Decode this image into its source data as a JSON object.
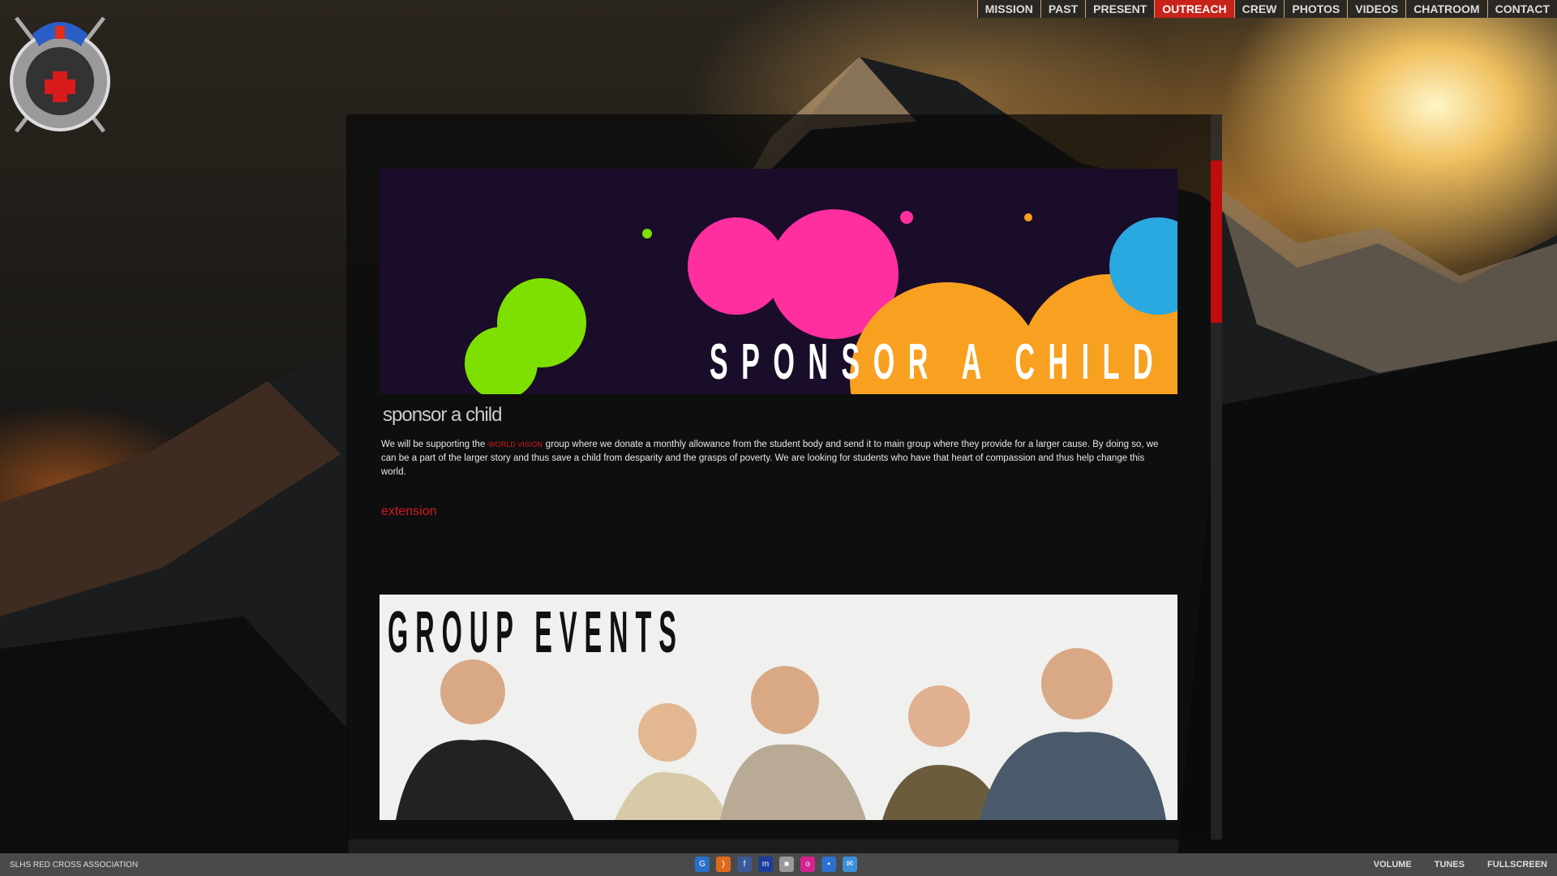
{
  "nav": {
    "items": [
      "MISSION",
      "PAST",
      "PRESENT",
      "OUTREACH",
      "CREW",
      "PHOTOS",
      "VIDEOS",
      "CHATROOM",
      "CONTACT"
    ],
    "active": "OUTREACH",
    "active_color": "#c7231a"
  },
  "banner": {
    "title": "SPONSOR A CHILD"
  },
  "section": {
    "title": "sponsor a child",
    "text_before": "We will be supporting the",
    "highlight": "WORLD VISION",
    "text_after": "group where we donate a monthly allowance from the student body and send it to main group where they provide for a larger cause. By doing so, we can be a part of the larger story and thus save a child from desparity and the grasps of poverty. We are looking for students who have that heart of compassion and thus help change this world.",
    "link": "extension"
  },
  "group_banner": {
    "title": "GROUP EVENTS"
  },
  "footer": {
    "site_name": "SLHS RED CROSS ASSOCIATION",
    "icons": [
      {
        "name": "google-icon",
        "color": "#2a6fc9"
      },
      {
        "name": "rss-icon",
        "color": "#e06a1c"
      },
      {
        "name": "facebook-icon",
        "color": "#3b5998"
      },
      {
        "name": "myspace-icon",
        "color": "#1b3e9c"
      },
      {
        "name": "delicious-icon",
        "color": "#999999"
      },
      {
        "name": "flickr-icon",
        "color": "#d4238f"
      },
      {
        "name": "delicious-blue-icon",
        "color": "#2b6fcf"
      },
      {
        "name": "windows-live-icon",
        "color": "#3a8fd8"
      }
    ],
    "volume": "VOLUME",
    "tunes": "TUNES",
    "fullscreen": "FULLSCREEN"
  }
}
